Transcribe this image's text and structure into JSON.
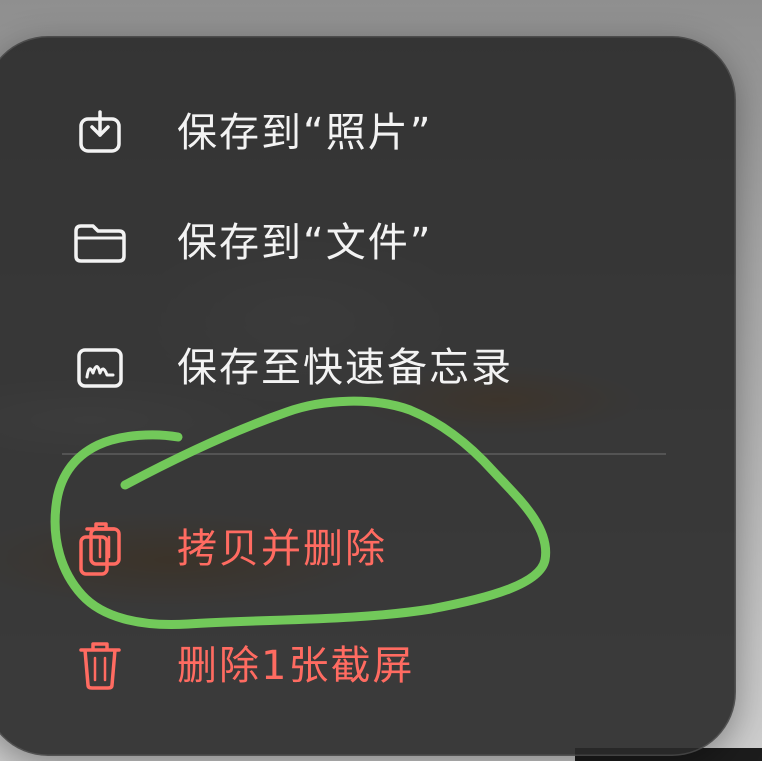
{
  "menu": {
    "items": [
      {
        "label": "保存到“照片”",
        "icon": "save-to-photos-icon"
      },
      {
        "label": "保存到“文件”",
        "icon": "folder-icon"
      },
      {
        "label": "保存至快速备忘录",
        "icon": "quick-note-icon"
      },
      {
        "label": "拷贝并删除",
        "icon": "copy-delete-icon"
      },
      {
        "label": "删除1张截屏",
        "icon": "trash-icon"
      }
    ]
  },
  "colors": {
    "menu_background": "#2a2a2a",
    "text_primary": "#f3f3f3",
    "text_destructive": "#ff6b61",
    "annotation_stroke": "#72c95a"
  }
}
